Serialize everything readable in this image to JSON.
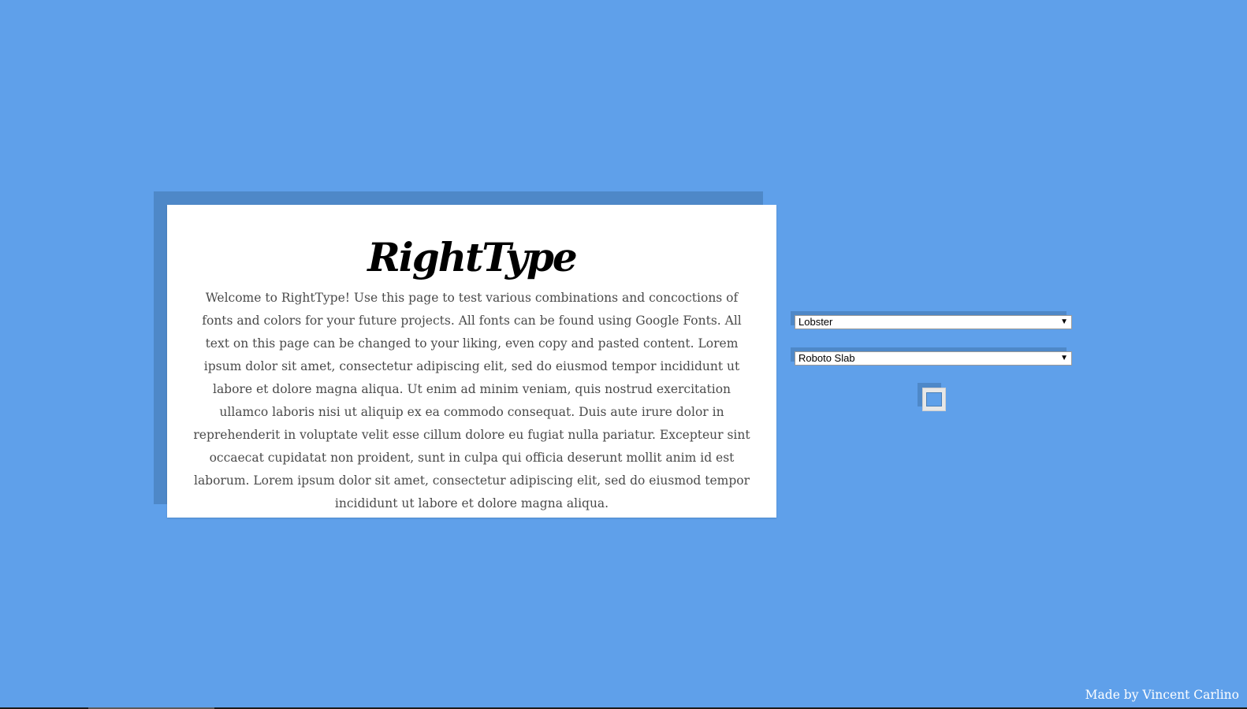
{
  "card": {
    "title": "RightType",
    "body": "Welcome to RightType! Use this page to test various combinations and concoctions of fonts and colors for your future projects. All fonts can be found using Google Fonts. All text on this page can be changed to your liking, even copy and pasted content. Lorem ipsum dolor sit amet, consectetur adipiscing elit, sed do eiusmod tempor incididunt ut labore et dolore magna aliqua. Ut enim ad minim veniam, quis nostrud exercitation ullamco laboris nisi ut aliquip ex ea commodo consequat. Duis aute irure dolor in reprehenderit in voluptate velit esse cillum dolore eu fugiat nulla pariatur. Excepteur sint occaecat cupidatat non proident, sunt in culpa qui officia deserunt mollit anim id est laborum. Lorem ipsum dolor sit amet, consectetur adipiscing elit, sed do eiusmod tempor incididunt ut labore et dolore magna aliqua."
  },
  "controls": {
    "heading_font": {
      "selected": "Lobster",
      "icon": "chevron-down-icon"
    },
    "body_font": {
      "selected": "Roboto Slab",
      "icon": "chevron-down-icon"
    },
    "color_picker": {
      "value": "#5fa0ea",
      "icon": "color-swatch-icon"
    }
  },
  "footer": {
    "credit": "Made by Vincent Carlino"
  },
  "colors": {
    "background": "#5fa0ea",
    "card_shadow": "#4e88c8",
    "card": "#ffffff",
    "title": "#000000",
    "body_text": "#4a4a4a"
  }
}
